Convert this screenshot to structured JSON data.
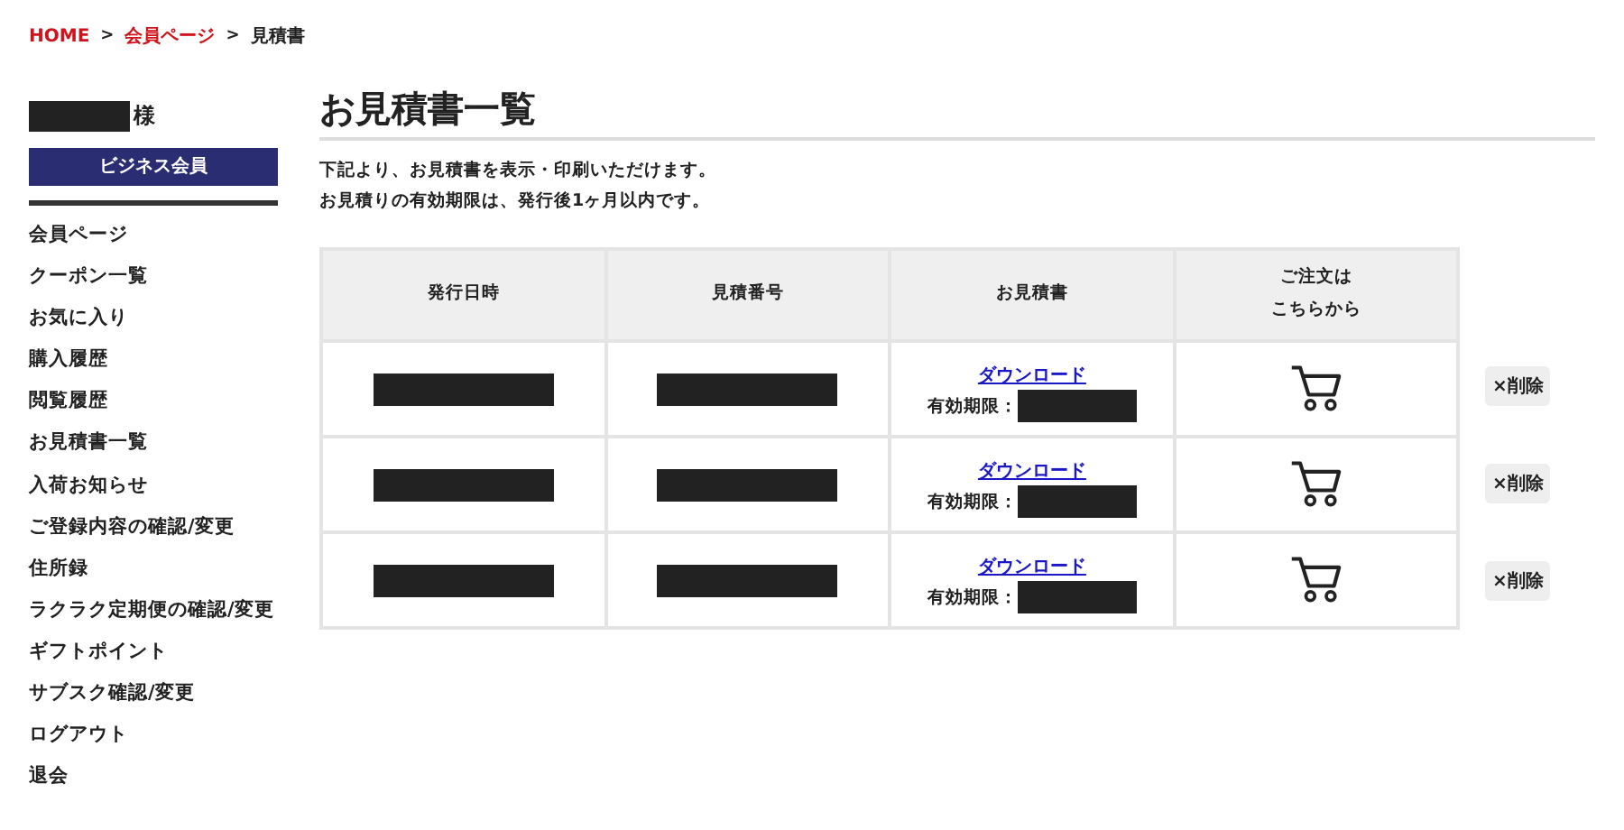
{
  "breadcrumb": [
    {
      "label": "HOME",
      "link": true
    },
    {
      "label": "会員ページ",
      "link": true
    },
    {
      "label": "見積書",
      "link": false
    }
  ],
  "breadcrumb_separator": ">",
  "sidebar": {
    "user_suffix": "様",
    "badge": "ビジネス会員",
    "items": [
      "会員ページ",
      "クーポン一覧",
      "お気に入り",
      "購入履歴",
      "閲覧履歴",
      "お見積書一覧",
      "入荷お知らせ",
      "ご登録内容の確認/変更",
      "住所録",
      "ラクラク定期便の確認/変更",
      "ギフトポイント",
      "サブスク確認/変更",
      "ログアウト",
      "退会"
    ]
  },
  "page_title": "お見積書一覧",
  "intro": [
    "下記より、お見積書を表示・印刷いただけます。",
    "お見積りの有効期限は、発行後1ヶ月以内です。"
  ],
  "table": {
    "columns": [
      [
        "発行日時"
      ],
      [
        "見積番号"
      ],
      [
        "お見積書"
      ],
      [
        "ご注文は",
        "こちらから"
      ]
    ],
    "rows": [
      {
        "download": "ダウンロード",
        "expiry_label": "有効期限：",
        "delete": "×削除"
      },
      {
        "download": "ダウンロード",
        "expiry_label": "有効期限：",
        "delete": "×削除"
      },
      {
        "download": "ダウンロード",
        "expiry_label": "有効期限：",
        "delete": "×削除"
      }
    ]
  }
}
